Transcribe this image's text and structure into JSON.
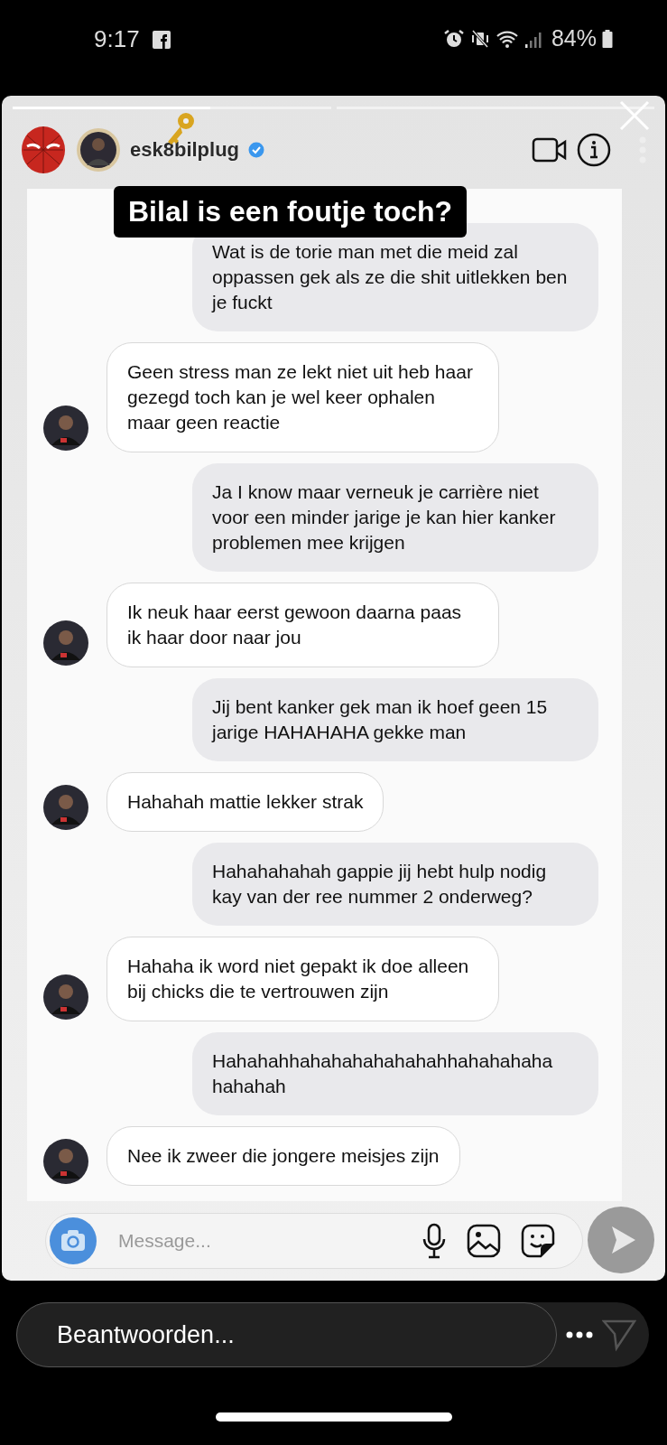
{
  "status_bar": {
    "time": "9:17",
    "battery": "84%"
  },
  "story": {
    "progress": {
      "level": 0.62
    },
    "username": "esk8bilplug",
    "verified": true,
    "caption": "Bilal is een foutje toch?"
  },
  "messages": [
    {
      "kind": "sent",
      "text": "Wat is de torie man met die meid zal oppassen gek als ze die shit uitlekken ben je fuckt"
    },
    {
      "kind": "received",
      "text": "Geen stress man ze lekt niet uit heb haar gezegd toch kan je wel keer ophalen maar geen reactie"
    },
    {
      "kind": "sent",
      "text": "Ja I know maar verneuk je carrière niet voor een minder jarige je kan hier kanker problemen mee krijgen"
    },
    {
      "kind": "received",
      "text": "Ik neuk haar eerst gewoon daarna paas ik haar door naar jou"
    },
    {
      "kind": "sent",
      "text": "Jij bent kanker gek man ik hoef geen 15 jarige HAHAHAHA gekke man"
    },
    {
      "kind": "received",
      "text": "Hahahah mattie lekker strak"
    },
    {
      "kind": "sent",
      "text": "Hahahahahah gappie jij hebt hulp nodig kay van der ree nummer 2 onderweg?"
    },
    {
      "kind": "received",
      "text": "Hahaha ik word niet gepakt ik doe alleen bij chicks die te vertrouwen zijn"
    },
    {
      "kind": "sent",
      "text": "Hahahahhahahahahahahahhahahahaha hahahah"
    },
    {
      "kind": "received",
      "text": "Nee ik zweer die jongere meisjes zijn"
    }
  ],
  "composer": {
    "placeholder": "Message..."
  },
  "reply": {
    "placeholder": "Beantwoorden..."
  }
}
